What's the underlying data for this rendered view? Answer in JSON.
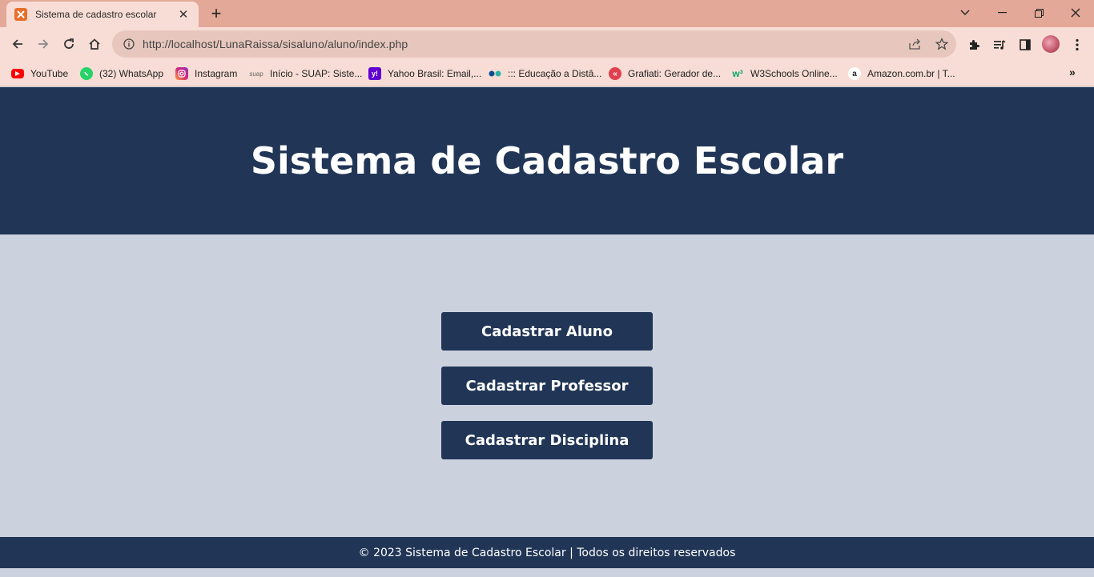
{
  "browser": {
    "tab_title": "Sistema de cadastro escolar",
    "tab_close": "✕",
    "new_tab": "+",
    "url": "http://localhost/LunaRaissa/sisaluno/aluno/index.php",
    "window_controls": {
      "dropdown": "⌄",
      "minimize": "—",
      "restore": "❐",
      "close": "✕"
    }
  },
  "bookmarks": [
    {
      "label": "YouTube",
      "icon": "youtube-icon"
    },
    {
      "label": "(32) WhatsApp",
      "icon": "whatsapp-icon"
    },
    {
      "label": "Instagram",
      "icon": "instagram-icon"
    },
    {
      "label": "Início - SUAP: Siste...",
      "icon": "suap-icon"
    },
    {
      "label": "Yahoo Brasil: Email,...",
      "icon": "yahoo-icon"
    },
    {
      "label": "::: Educação a Distâ...",
      "icon": "ead-icon"
    },
    {
      "label": "Grafiati: Gerador de...",
      "icon": "grafiati-icon"
    },
    {
      "label": "W3Schools Online...",
      "icon": "w3schools-icon"
    },
    {
      "label": "Amazon.com.br | T...",
      "icon": "amazon-icon"
    }
  ],
  "bookmarks_more": "»",
  "page": {
    "title": "Sistema de Cadastro Escolar",
    "buttons": [
      {
        "label": "Cadastrar Aluno"
      },
      {
        "label": "Cadastrar Professor"
      },
      {
        "label": "Cadastrar Disciplina"
      }
    ],
    "footer": "© 2023 Sistema de Cadastro Escolar | Todos os direitos reservados"
  },
  "colors": {
    "header_bg": "#213556",
    "content_bg": "#ccd1de",
    "button_bg": "#213556",
    "chrome_titlebar": "#e3a898",
    "chrome_toolbar": "#f7ddd5"
  }
}
